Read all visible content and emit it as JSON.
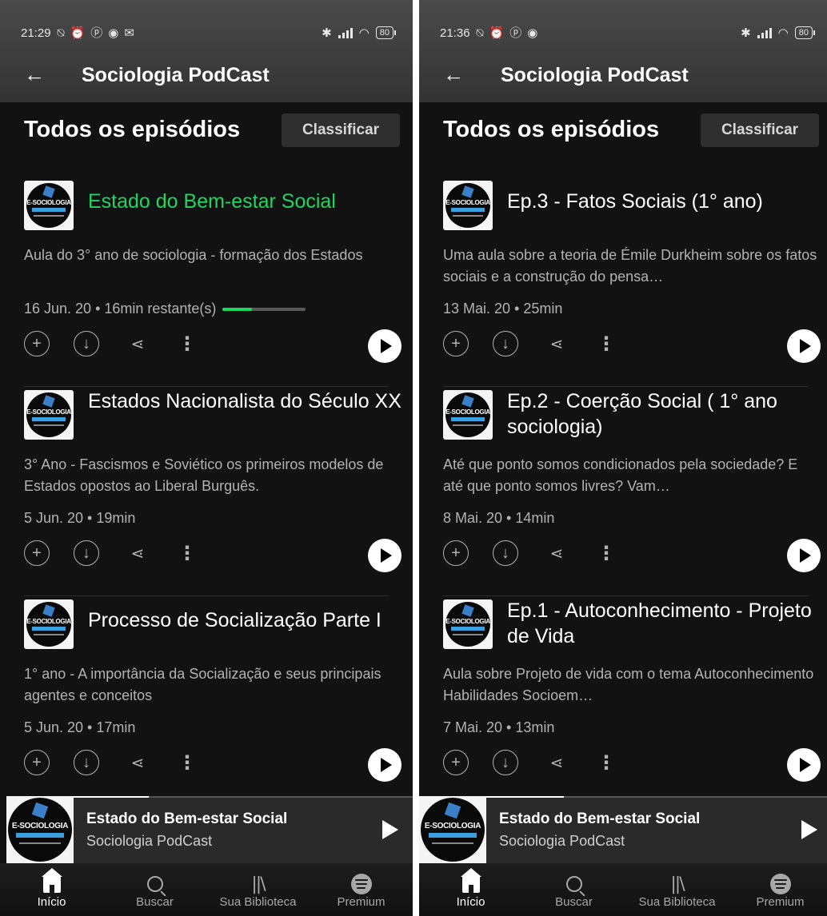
{
  "screens": [
    {
      "status": {
        "time": "21:29",
        "battery": "80"
      },
      "header": {
        "back": "←",
        "title": "Sociologia PodCast"
      },
      "section": {
        "title": "Todos os episódios",
        "sort_label": "Classificar"
      },
      "episodes": [
        {
          "title": "Estado do Bem-estar Social",
          "active": true,
          "desc": "Aula do 3° ano de sociologia - formação dos Estados",
          "meta": "16 Jun. 20 • 16min restante(s)",
          "progress": 0.35
        },
        {
          "title": "Estados Nacionalista do Século XX",
          "active": false,
          "desc": "3° Ano - Fascismos e Soviético os primeiros modelos de Estados opostos ao Liberal Burguês.",
          "meta": "5 Jun. 20 • 19min"
        },
        {
          "title": "Processo de Socialização Parte I",
          "active": false,
          "desc": "1° ano - A importância da Socialização e seus principais agentes e conceitos",
          "meta": "5 Jun. 20 • 17min"
        }
      ],
      "mini_player": {
        "title": "Estado do Bem-estar Social",
        "subtitle": "Sociologia PodCast",
        "progress": 0.35
      },
      "nav": [
        "Início",
        "Buscar",
        "Sua Biblioteca",
        "Premium"
      ]
    },
    {
      "status": {
        "time": "21:36",
        "battery": "80"
      },
      "header": {
        "back": "←",
        "title": "Sociologia PodCast"
      },
      "section": {
        "title": "Todos os episódios",
        "sort_label": "Classificar"
      },
      "episodes": [
        {
          "title": "Ep.3 - Fatos Sociais (1° ano)",
          "active": false,
          "desc": "Uma aula sobre a teoria de Émile Durkheim sobre os fatos sociais e a construção do pensa…",
          "meta": "13 Mai. 20 • 25min"
        },
        {
          "title": "Ep.2 - Coerção Social ( 1° ano sociologia)",
          "active": false,
          "desc": "Até que ponto somos condicionados pela sociedade? E até que ponto somos livres? Vam…",
          "meta": "8 Mai. 20 • 14min"
        },
        {
          "title": "Ep.1 - Autoconhecimento - Projeto de Vida",
          "active": false,
          "desc": "Aula sobre Projeto de vida com o tema Autoconhecimento Habilidades Socioem…",
          "meta": "7 Mai. 20 • 13min"
        }
      ],
      "mini_player": {
        "title": "Estado do Bem-estar Social",
        "subtitle": "Sociologia PodCast",
        "progress": 0.35
      },
      "nav": [
        "Início",
        "Buscar",
        "Sua Biblioteca",
        "Premium"
      ]
    }
  ],
  "logo_text": "E-SOCIOLOGIA",
  "colors": {
    "accent": "#1ed760",
    "background": "#121212",
    "mini_player": "#2a2a2a"
  },
  "icons": {
    "add": "plus-circle-icon",
    "download": "download-circle-icon",
    "share": "share-icon",
    "more": "more-vertical-icon",
    "play": "play-icon"
  }
}
